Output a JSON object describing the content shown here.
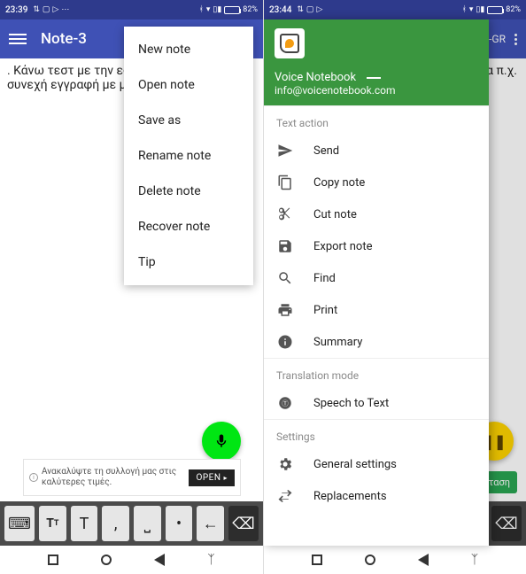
{
  "left": {
    "status": {
      "time": "23:39",
      "battery": "82%"
    },
    "appbar": {
      "title": "Note-3"
    },
    "body": {
      "line1": ". Κάνω τεστ με την εφ",
      "line2": "συνεχή  εγγραφή με μ"
    },
    "menu": [
      "New note",
      "Open note",
      "Save as",
      "Rename note",
      "Delete note",
      "Recover note",
      "Tip"
    ],
    "ad": {
      "text": "Ανακαλύψτε τη συλλογή μας στις καλύτερες τιμές.",
      "button": "OPEN"
    },
    "keys": [
      "⌨",
      "T⇵",
      "T",
      ",",
      "␣",
      "•",
      "←",
      "⌫"
    ]
  },
  "right": {
    "status": {
      "time": "23:44",
      "battery": "82%"
    },
    "appbar": {
      "lang": "EL-GR"
    },
    "body_tail": "ρματα π.χ.",
    "install": "Εγκατάσταση",
    "drawer": {
      "name": "Voice Notebook",
      "email": "info@voicenotebook.com",
      "sections": [
        {
          "title": "Text action",
          "items": [
            {
              "icon": "send",
              "label": "Send"
            },
            {
              "icon": "copy",
              "label": "Copy note"
            },
            {
              "icon": "cut",
              "label": "Cut note"
            },
            {
              "icon": "save",
              "label": "Export note"
            },
            {
              "icon": "find",
              "label": "Find"
            },
            {
              "icon": "print",
              "label": "Print"
            },
            {
              "icon": "info",
              "label": "Summary"
            }
          ]
        },
        {
          "title": "Translation mode",
          "items": [
            {
              "icon": "lang",
              "label": "Speech to Text"
            }
          ]
        },
        {
          "title": "Settings",
          "items": [
            {
              "icon": "gear",
              "label": "General settings"
            },
            {
              "icon": "swap",
              "label": "Replacements"
            }
          ]
        }
      ]
    }
  }
}
